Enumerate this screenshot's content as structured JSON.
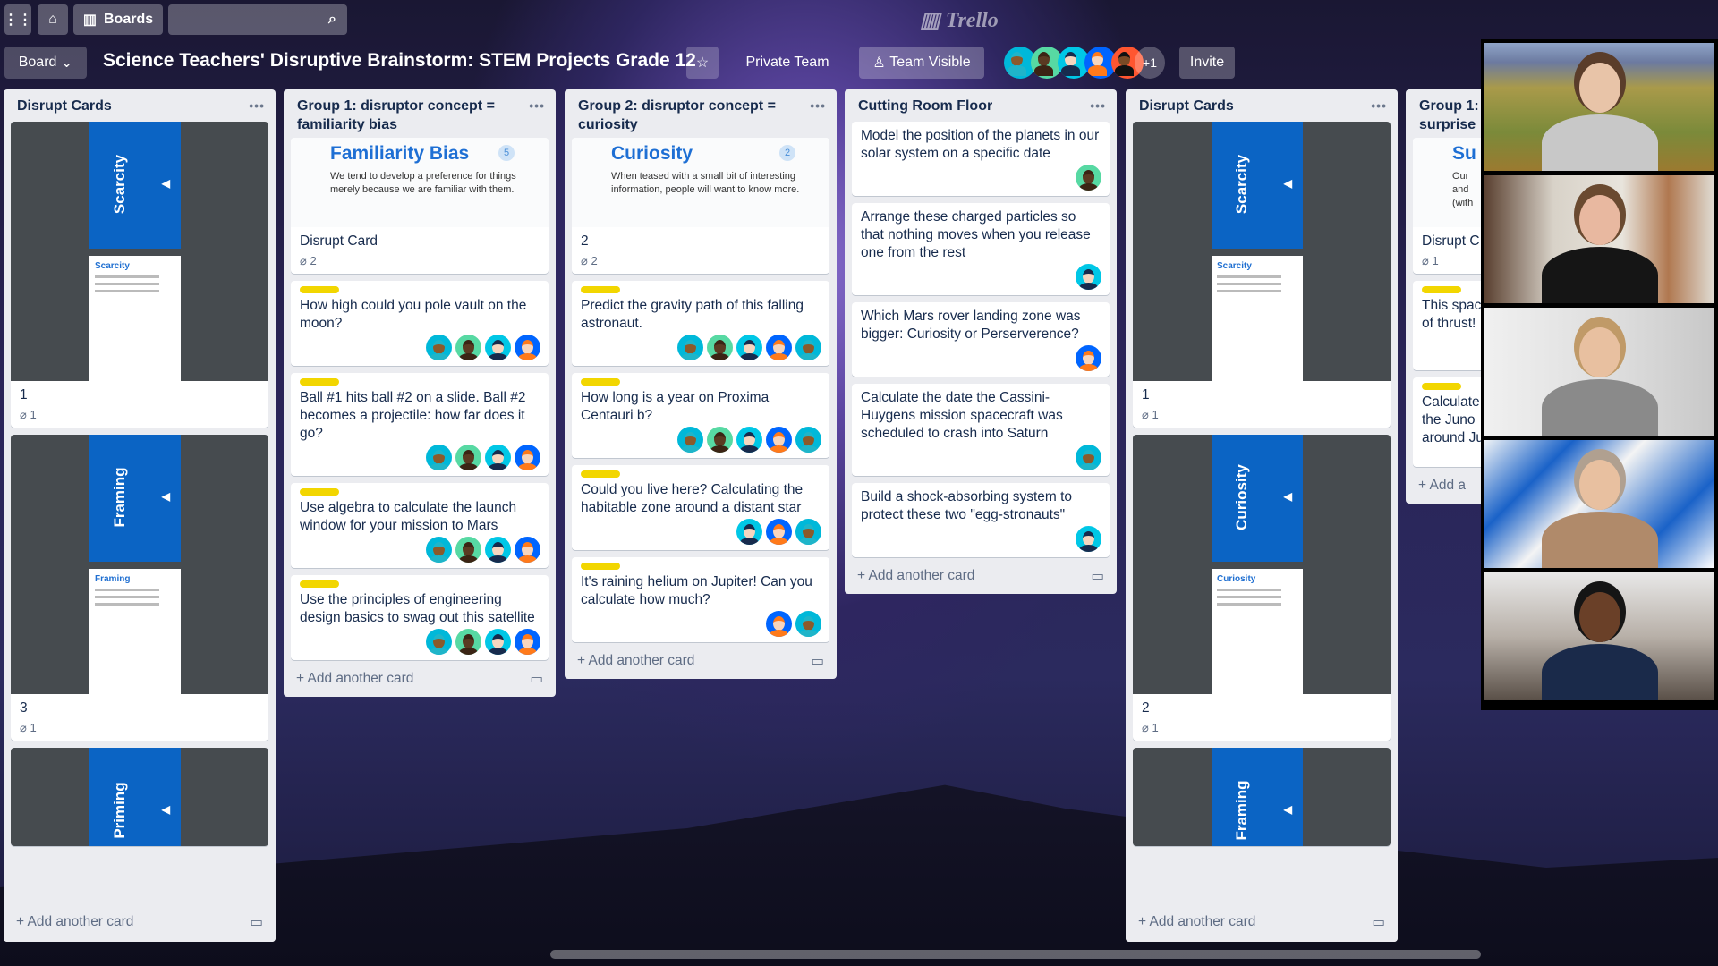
{
  "topbar": {
    "apps_icon": "grid-icon",
    "home_icon": "home-icon",
    "boards_label": "Boards",
    "search_icon": "search-icon",
    "logo": "Trello"
  },
  "header": {
    "board_menu": "Board",
    "board_title": "Science Teachers' Disruptive Brainstorm: STEM Projects Grade 12",
    "star_icon": "star-icon",
    "team": "Private Team",
    "visibility": "Team Visible",
    "members": [
      "a",
      "b",
      "c",
      "d",
      "e"
    ],
    "more_members": "+1",
    "invite": "Invite"
  },
  "avatar_colors": {
    "a": {
      "bg": "#00b8d9",
      "skin": "#8b5a2b",
      "top": "#1fb5c9"
    },
    "b": {
      "bg": "#57d9a3",
      "skin": "#5a3a22",
      "top": "#3b2414"
    },
    "c": {
      "bg": "#00c7e6",
      "skin": "#f5d6c0",
      "top": "#172b4d"
    },
    "d": {
      "bg": "#0065ff",
      "skin": "#f7d5bd",
      "top": "#ff7a1a"
    },
    "e": {
      "bg": "#ff5630",
      "skin": "#7a4a25",
      "top": "#111"
    }
  },
  "lists": [
    {
      "title": "Disrupt Cards",
      "cards": [
        {
          "cover": "Scarcity",
          "mini_title": "Scarcity",
          "title": "1",
          "attachments": "1"
        },
        {
          "cover": "Framing",
          "mini_title": "Framing",
          "title": "3",
          "attachments": "1"
        },
        {
          "cover": "Priming",
          "mini_title": "",
          "title": "",
          "attachments": ""
        }
      ],
      "add": "Add another card"
    },
    {
      "title": "Group 1: disruptor concept = familiarity bias",
      "cards": [
        {
          "image_title": "Familiarity Bias",
          "image_badge": "5",
          "image_desc": "We tend to develop a preference for things merely because we are familiar with them.",
          "title": "Disrupt Card",
          "attachments": "2"
        },
        {
          "label": true,
          "title": "How high could you pole vault on the moon?",
          "members": [
            "a",
            "b",
            "c",
            "d"
          ]
        },
        {
          "label": true,
          "title": "Ball #1 hits ball #2 on a slide. Ball #2 becomes a projectile: how far does it go?",
          "members": [
            "a",
            "b",
            "c",
            "d"
          ]
        },
        {
          "label": true,
          "title": "Use algebra to calculate the launch window for your mission to Mars",
          "members": [
            "a",
            "b",
            "c",
            "d"
          ]
        },
        {
          "label": true,
          "title": "Use the principles of engineering design basics to swag out this satellite",
          "members": [
            "a",
            "b",
            "c",
            "d"
          ]
        }
      ],
      "add": "Add another card"
    },
    {
      "title": "Group 2: disruptor concept = curiosity",
      "cards": [
        {
          "image_title": "Curiosity",
          "image_badge": "2",
          "image_desc": "When teased with a small bit of interesting information, people will want to know more.",
          "title": "2",
          "attachments": "2"
        },
        {
          "label": true,
          "title": "Predict the gravity path of this falling astronaut.",
          "members": [
            "a",
            "b",
            "c",
            "d",
            "a"
          ]
        },
        {
          "label": true,
          "title": "How long is a year on Proxima Centauri b?",
          "members": [
            "a",
            "b",
            "c",
            "d",
            "a"
          ]
        },
        {
          "label": true,
          "title": "Could you live here? Calculating the habitable zone around a distant star",
          "members": [
            "c",
            "d",
            "a"
          ]
        },
        {
          "label": true,
          "title": "It's raining helium on Jupiter! Can you calculate how much?",
          "members": [
            "d",
            "a"
          ]
        }
      ],
      "add": "Add another card"
    },
    {
      "title": "Cutting Room Floor",
      "cards": [
        {
          "title": "Model the position of the planets in our solar system on a specific date",
          "members": [
            "b"
          ]
        },
        {
          "title": "Arrange these charged particles so that nothing moves when you release one from the rest",
          "members": [
            "c"
          ]
        },
        {
          "title": "Which Mars rover landing zone was bigger: Curiosity or Perserverence?",
          "members": [
            "d"
          ]
        },
        {
          "title": "Calculate the date the Cassini-Huygens mission spacecraft was scheduled to crash into Saturn",
          "members": [
            "a"
          ]
        },
        {
          "title": "Build a shock-absorbing system to protect these two \"egg-stronauts\"",
          "members": [
            "c"
          ]
        }
      ],
      "add": "Add another card"
    },
    {
      "title": "Disrupt Cards",
      "cards": [
        {
          "cover": "Scarcity",
          "mini_title": "Scarcity",
          "title": "1",
          "attachments": "1"
        },
        {
          "cover": "Curiosity",
          "mini_title": "Curiosity",
          "title": "2",
          "attachments": "1"
        },
        {
          "cover": "Framing",
          "mini_title": "",
          "title": "",
          "attachments": ""
        }
      ],
      "add": "Add another card"
    },
    {
      "title": "Group 1:\nsurprise",
      "cards": [
        {
          "image_title": "Su",
          "image_badge": "",
          "image_desc": "Our\nand\n(with",
          "title": "Disrupt C",
          "attachments": "1"
        },
        {
          "label": true,
          "title": "This spac\nof thrust!",
          "members": []
        },
        {
          "label": true,
          "title": "Calculate\nthe Juno\naround Ju",
          "members": []
        }
      ],
      "add": "Add a"
    }
  ],
  "video_participants": [
    {
      "bg": "linear-gradient(180deg,#8fa4c8 0%,#6c7aa0 15%,#a99a4a 35%,#7b8a3a 70%,#9b7a30 100%)",
      "hair": "#5a3d2a",
      "skin": "#e8c4a8",
      "shirt": "#c8c8c8"
    },
    {
      "bg": "linear-gradient(90deg,#5a4030 0%,#d8d2c8 30%,#e8e4dc 60%,#b07850 80%,#e0dcd4 100%)",
      "hair": "#6a4a30",
      "skin": "#e8b8a0",
      "shirt": "#151515"
    },
    {
      "bg": "linear-gradient(90deg,#f0f0f0,#dcdcdc 60%,#c8c8c8)",
      "hair": "#c09a68",
      "skin": "#e8c0a0",
      "shirt": "#8a8a8a"
    },
    {
      "bg": "linear-gradient(135deg,#eef2f6 0%,#1a62c8 25%,#f4f4f4 45%,#1a62c8 75%,#ffffff 100%)",
      "hair": "#b0a090",
      "skin": "#e8c0a0",
      "shirt": "#b08a6a"
    },
    {
      "bg": "linear-gradient(180deg,#e8e8e8,#b8b0a8 50%,#5a5048 100%)",
      "hair": "#151515",
      "skin": "#6a4028",
      "shirt": "#1a2a4a"
    }
  ]
}
